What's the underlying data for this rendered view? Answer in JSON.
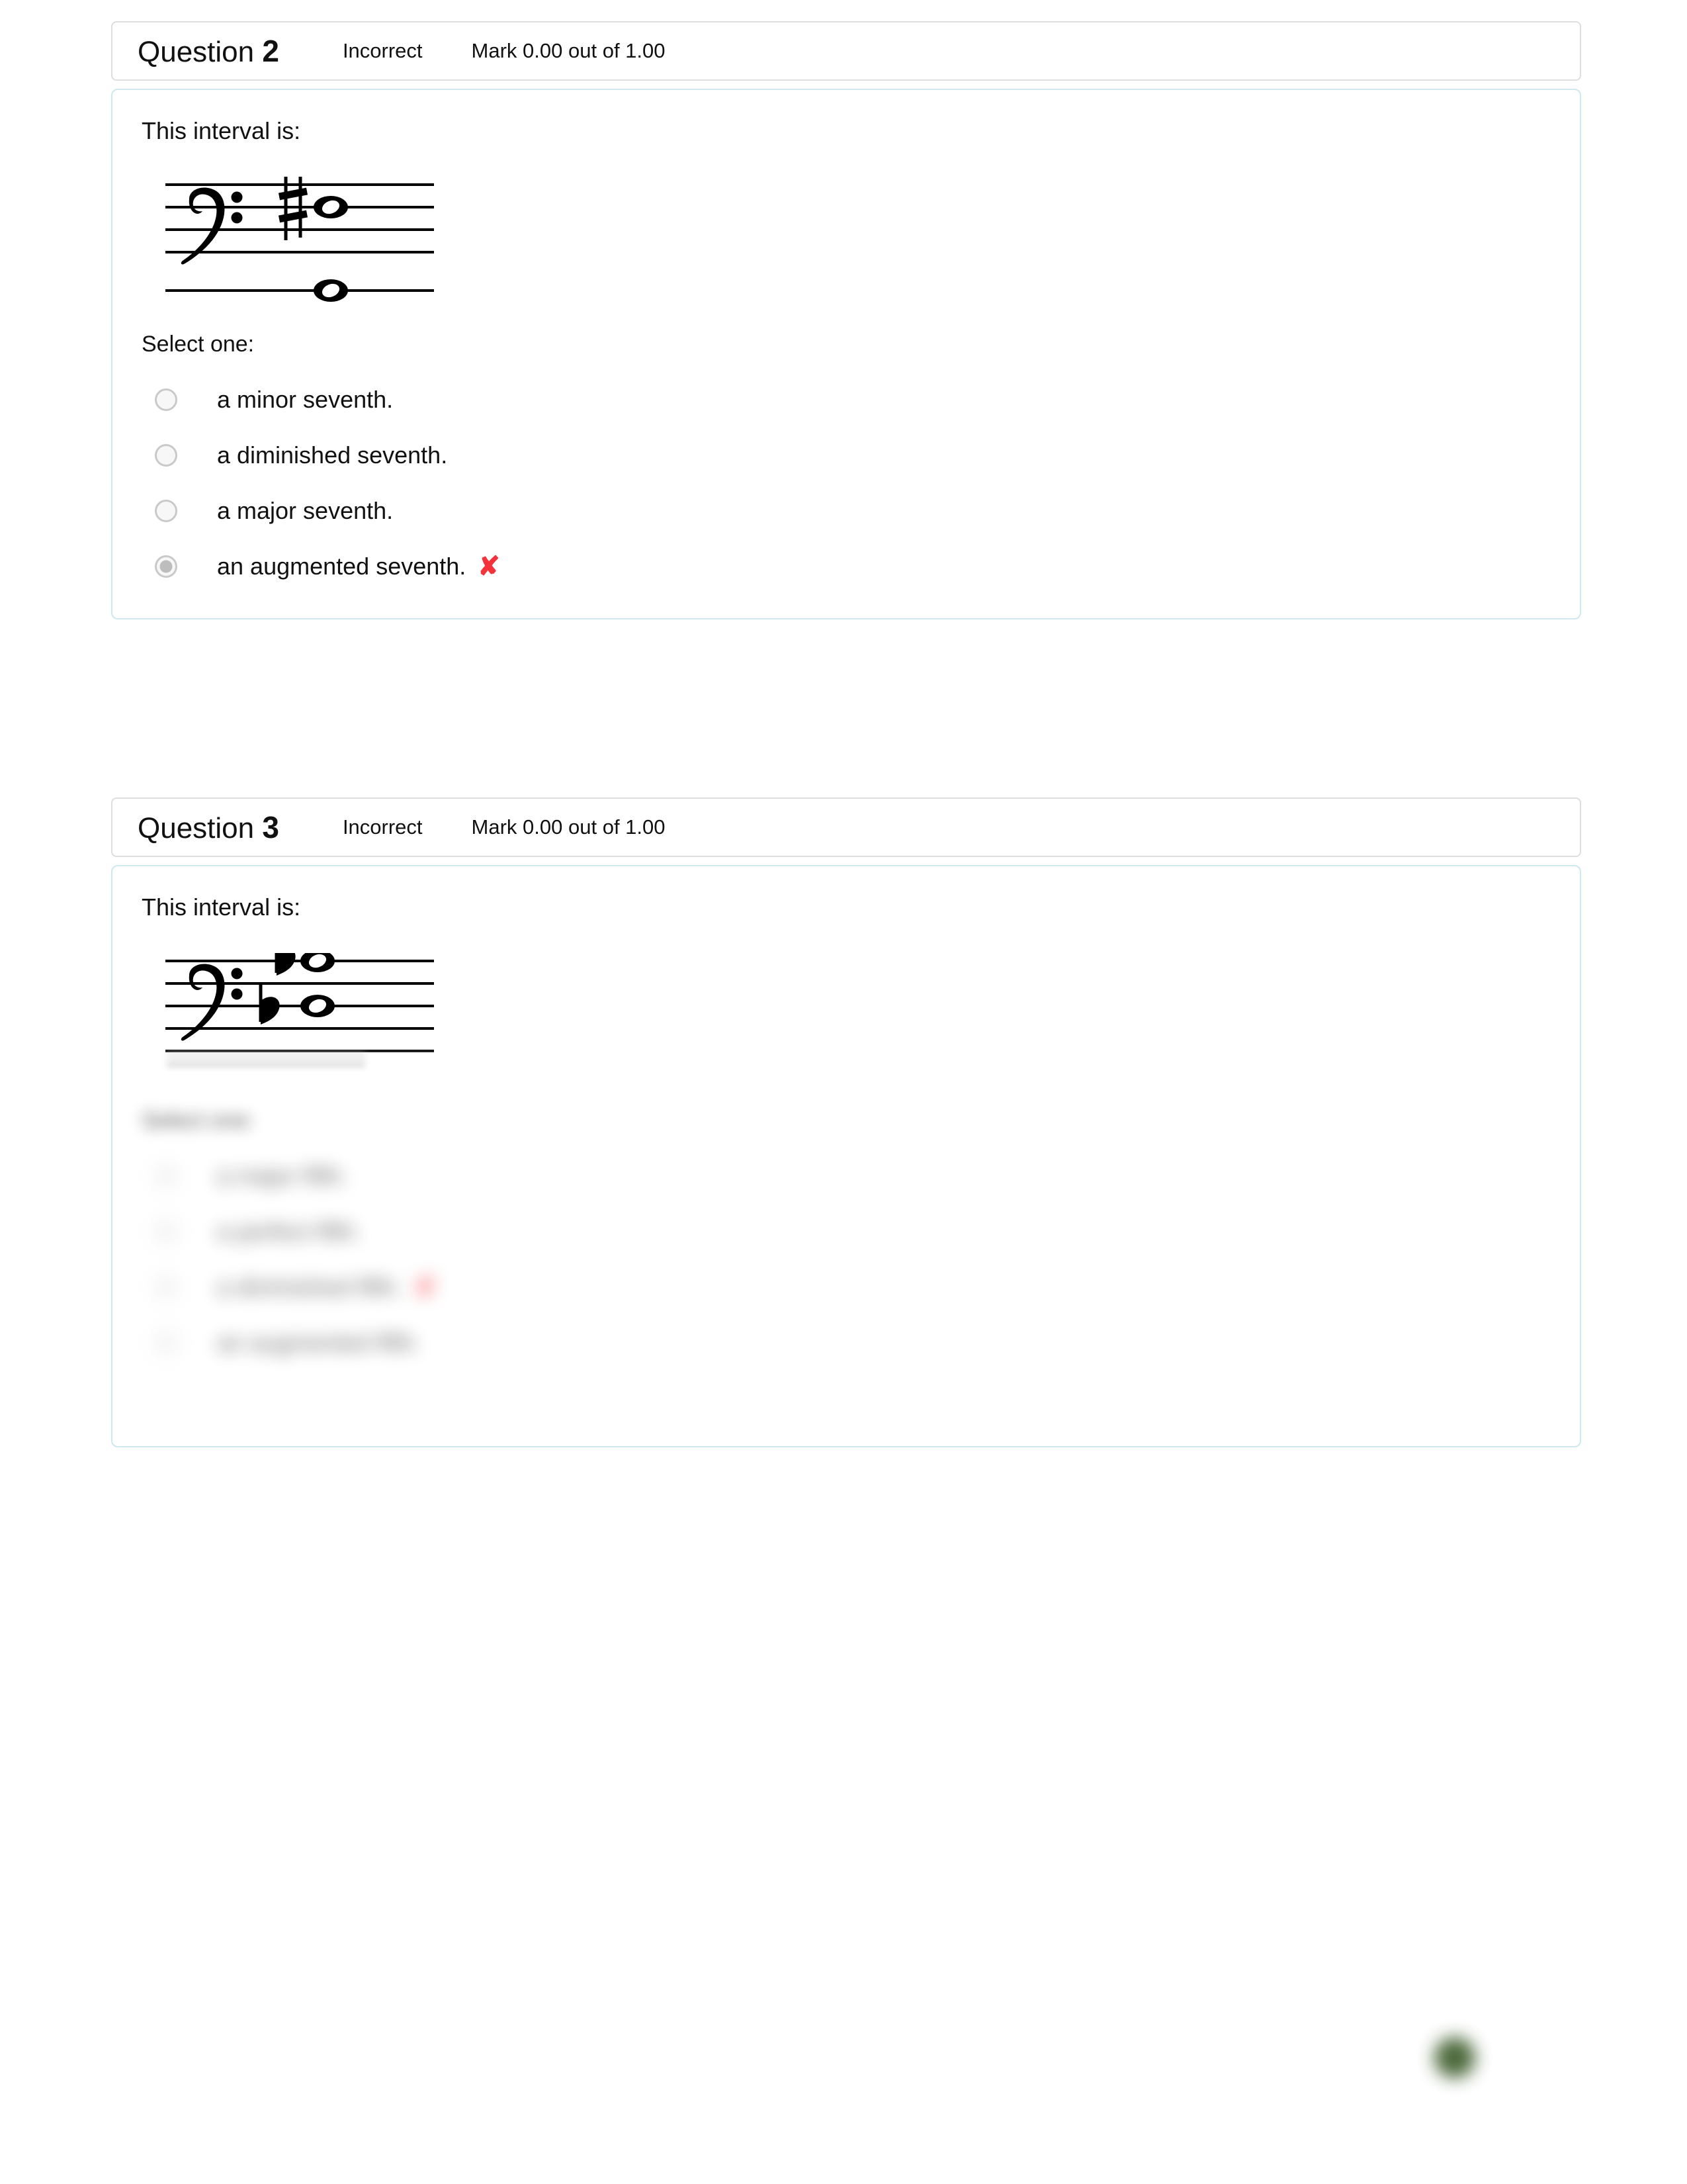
{
  "page": {
    "background": "#ffffff",
    "accent_border": "#cfe7ef",
    "header_border": "#dedede",
    "wrong_color": "#f4323c",
    "bubble_color": "#3d5c2b"
  },
  "questions": [
    {
      "title_word": "Question",
      "number": "2",
      "state": "Incorrect",
      "mark": "Mark 0.00 out of 1.00",
      "prompt": "This interval is:",
      "select_label": "Select one:",
      "notation": {
        "clef": "bass-clef",
        "accidentals": [
          "sharp"
        ],
        "notes": [
          "whole-note-upper-sharp",
          "whole-note-lower-ledger"
        ]
      },
      "options": [
        {
          "label": "a minor seventh.",
          "selected": false,
          "wrong": false
        },
        {
          "label": "a diminished seventh.",
          "selected": false,
          "wrong": false
        },
        {
          "label": "a major seventh.",
          "selected": false,
          "wrong": false
        },
        {
          "label": "an augmented seventh.",
          "selected": true,
          "wrong": true,
          "mark": "✘"
        }
      ]
    },
    {
      "title_word": "Question",
      "number": "3",
      "state": "Incorrect",
      "mark": "Mark 0.00 out of 1.00",
      "prompt": "This interval is:",
      "select_label": "Select one:",
      "notation": {
        "clef": "bass-clef",
        "accidentals": [
          "flat",
          "flat"
        ],
        "notes": [
          "whole-note-upper-flat",
          "whole-note-lower-flat"
        ]
      },
      "options": [
        {
          "label": "a major fifth.",
          "selected": false,
          "wrong": false
        },
        {
          "label": "a perfect fifth.",
          "selected": false,
          "wrong": false
        },
        {
          "label": "a diminished fifth.",
          "selected": false,
          "wrong": true,
          "mark": "✘"
        },
        {
          "label": "an augmented fifth.",
          "selected": false,
          "wrong": false
        }
      ]
    }
  ]
}
